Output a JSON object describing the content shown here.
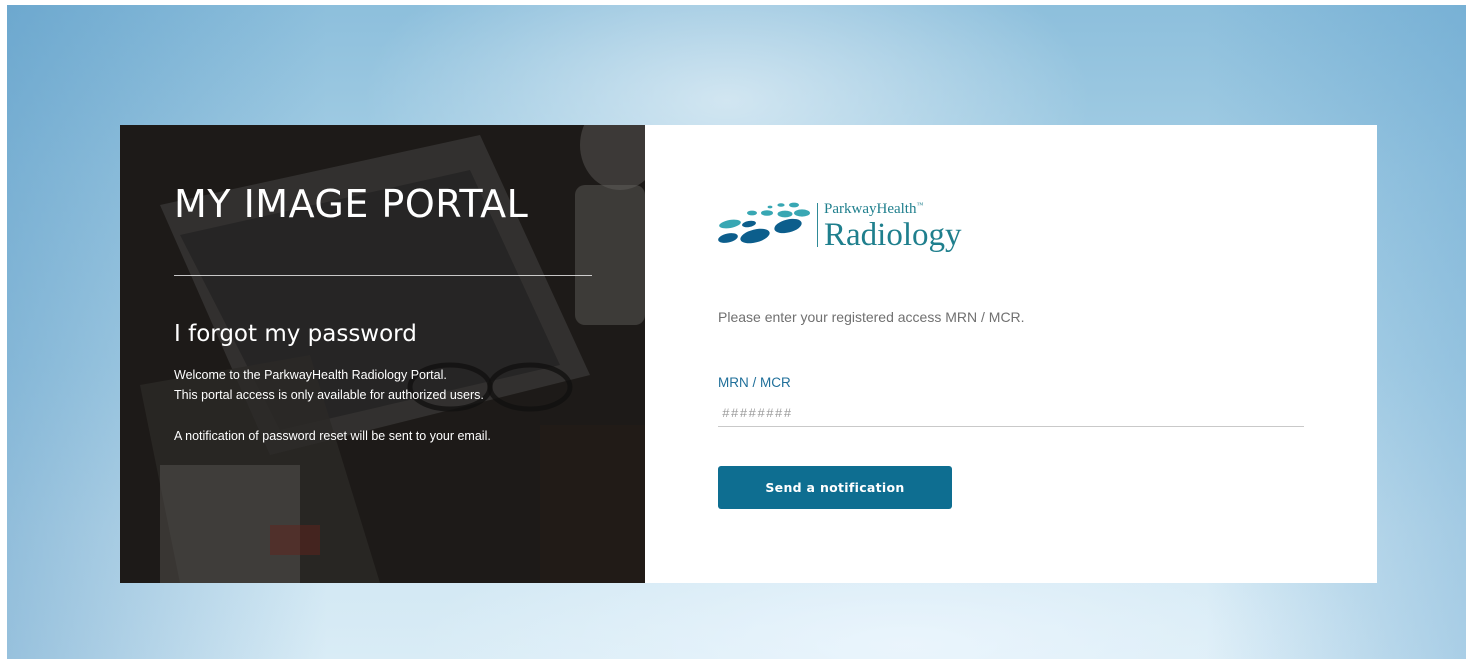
{
  "left_panel": {
    "portal_title": "MY IMAGE PORTAL",
    "heading": "I forgot my password",
    "welcome_line_1": "Welcome to the ParkwayHealth Radiology Portal.",
    "welcome_line_2": "This portal access is only available for authorized users.",
    "notification_line": "A notification of password reset will be sent to your email."
  },
  "logo": {
    "brand": "ParkwayHealth",
    "trademark": "™",
    "product": "Radiology"
  },
  "form": {
    "instruction": "Please enter your registered access MRN / MCR.",
    "field_label": "MRN / MCR",
    "field_placeholder": "########",
    "field_value": "",
    "submit_label": "Send a notification"
  },
  "colors": {
    "brand_teal": "#1f7f8d",
    "button_blue": "#0e6e91",
    "label_blue": "#1f6f9a",
    "logo_dark_blue": "#0c5e8c",
    "logo_light_teal": "#38a7b3"
  }
}
